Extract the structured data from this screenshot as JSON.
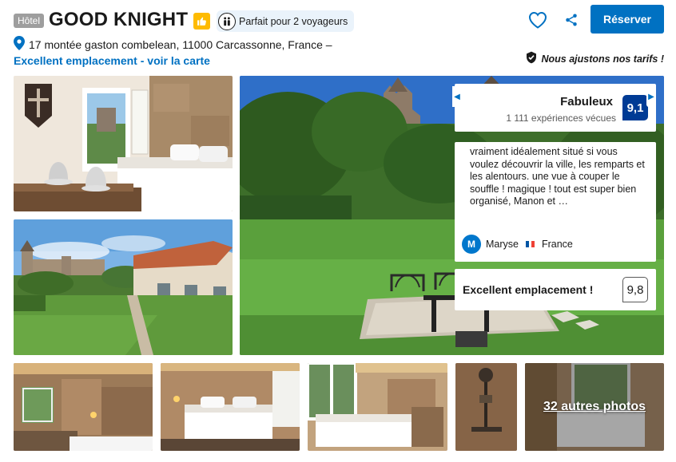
{
  "header": {
    "type_badge": "Hôtel",
    "hotel_name": "GOOD KNIGHT",
    "travel_tag": "Parfait pour 2 voyageurs",
    "address": "17 montée gaston combelean, 11000 Carcassonne, France –",
    "map_link": "Excellent emplacement - voir la carte"
  },
  "actions": {
    "reserve_label": "Réserver",
    "price_guarantee": "Nous ajustons nos tarifs !"
  },
  "review": {
    "score_word": "Fabuleux",
    "review_count": "1 111 expériences vécues",
    "score": "9,1",
    "quote": "vraiment idéalement situé si vous voulez découvrir la ville, les remparts et les alentours. une vue à couper le souffle ! magique ! tout est super bien organisé, Manon et …",
    "author_initial": "M",
    "author_name": "Maryse",
    "author_country": "France",
    "location_label": "Excellent emplacement !",
    "location_score": "9,8"
  },
  "gallery": {
    "more_photos": "32 autres photos"
  },
  "colors": {
    "brand_blue": "#0071c2",
    "score_navy": "#003b95",
    "genius_yellow": "#febb02"
  },
  "icons": [
    "thumbs-up-icon",
    "travellers-icon",
    "map-pin-icon",
    "heart-icon",
    "share-icon",
    "price-shield-icon",
    "chevron-left-icon",
    "chevron-right-icon",
    "flag-icon"
  ]
}
